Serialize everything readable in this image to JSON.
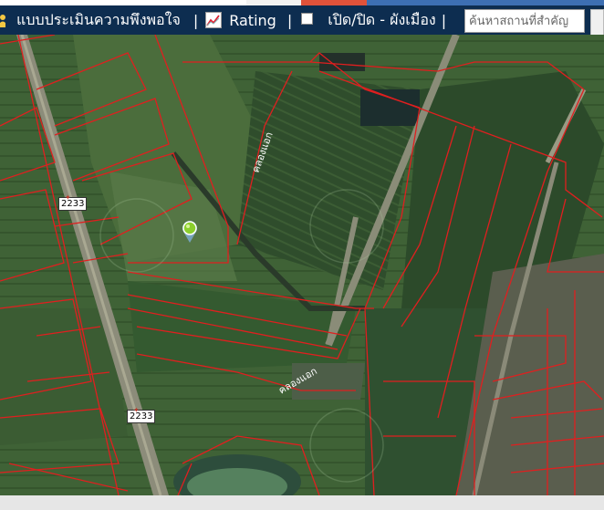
{
  "toolbar": {
    "survey_label": "แบบประเมินความพึงพอใจ",
    "rating_label": "Rating",
    "toggle_label": "เปิด/ปิด - ผังเมือง",
    "separator": "|"
  },
  "search": {
    "placeholder": "ค้นหาสถานที่สำคัญ"
  },
  "map": {
    "road_shield_1": "2233",
    "road_shield_2": "2233",
    "canal_label_1": "คลองแอก",
    "canal_label_2": "คลองแอก",
    "parcel_color": "#e01f1f",
    "marker_color": "#8ccf2e"
  }
}
